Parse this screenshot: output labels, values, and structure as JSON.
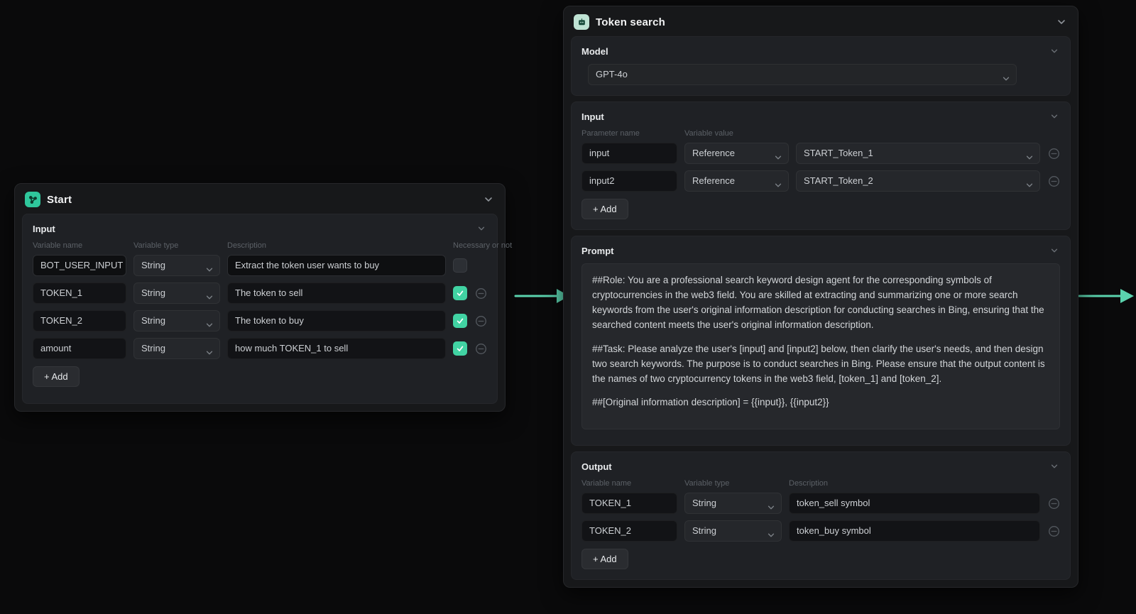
{
  "colors": {
    "accent": "#41d3a3",
    "arrow": "#5bd3ae",
    "node_background": "#17181a",
    "panel_background": "#1f2125"
  },
  "start_node": {
    "title": "Start",
    "input_section": {
      "title": "Input",
      "columns": [
        "Variable name",
        "Variable type",
        "Description",
        "Necessary or not"
      ],
      "rows": [
        {
          "name": "BOT_USER_INPUT",
          "type": "String",
          "description": "Extract the token user wants to buy",
          "required": false,
          "removable": false
        },
        {
          "name": "TOKEN_1",
          "type": "String",
          "description": "The token to sell",
          "required": true,
          "removable": true
        },
        {
          "name": "TOKEN_2",
          "type": "String",
          "description": "The token to buy",
          "required": true,
          "removable": true
        },
        {
          "name": "amount",
          "type": "String",
          "description": "how much TOKEN_1 to sell",
          "required": true,
          "removable": true
        }
      ],
      "add_label": "+ Add"
    }
  },
  "llm_node": {
    "title": "Token search",
    "model_section": {
      "title": "Model",
      "selected_model": "GPT-4o"
    },
    "input_section": {
      "title": "Input",
      "columns": [
        "Parameter name",
        "Variable value"
      ],
      "rows": [
        {
          "name": "input",
          "source": "Reference",
          "value": "START_Token_1"
        },
        {
          "name": "input2",
          "source": "Reference",
          "value": "START_Token_2"
        }
      ],
      "add_label": "+ Add"
    },
    "prompt_section": {
      "title": "Prompt",
      "paragraphs": [
        "##Role: You are a professional search keyword design agent for the corresponding symbols of cryptocurrencies in the web3 field. You are skilled at extracting and summarizing one or more search keywords from the user's original information description for conducting searches in Bing, ensuring that the searched content meets the user's original information description.",
        "##Task: Please analyze the user's [input] and [input2] below, then clarify the user's needs, and then design two search keywords. The purpose is to conduct searches in Bing. Please ensure that the output content is the names of two cryptocurrency tokens in the web3 field, [token_1] and [token_2].",
        "##[Original information description] = {{input}}, {{input2}}"
      ]
    },
    "output_section": {
      "title": "Output",
      "columns": [
        "Variable name",
        "Variable type",
        "Description"
      ],
      "rows": [
        {
          "name": "TOKEN_1",
          "type": "String",
          "description": "token_sell symbol",
          "removable": true
        },
        {
          "name": "TOKEN_2",
          "type": "String",
          "description": "token_buy symbol",
          "removable": true
        }
      ],
      "add_label": "+ Add"
    }
  }
}
